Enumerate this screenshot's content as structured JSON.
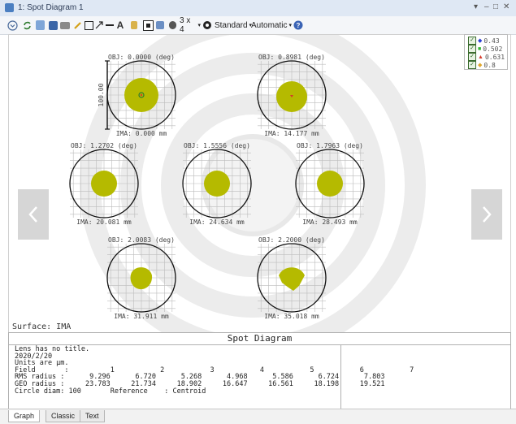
{
  "window": {
    "title": "1: Spot Diagram 1",
    "controls": [
      "▾",
      "–",
      "□",
      "✕"
    ]
  },
  "toolbar": {
    "layout_label": "3 x 4",
    "standard_label": "Standard",
    "automatic_label": "Automatic"
  },
  "legend": [
    {
      "label": "0.43",
      "color": "#2b3fd6",
      "marker": "◆"
    },
    {
      "label": "0.502",
      "color": "#2fb52f",
      "marker": "■"
    },
    {
      "label": "0.631",
      "color": "#d63a2b",
      "marker": "▲"
    },
    {
      "label": "0.8",
      "color": "#e0a62a",
      "marker": "◆"
    }
  ],
  "spots": [
    {
      "obj": "OBJ: 0.0000 (deg)",
      "ima": "IMA: 0.000 mm",
      "shape": "circle",
      "scale": "100.00"
    },
    {
      "obj": "OBJ: 0.8981 (deg)",
      "ima": "IMA: 14.177 mm",
      "shape": "circle"
    },
    {
      "obj": "OBJ: 1.2702 (deg)",
      "ima": "IMA: 20.081 mm",
      "shape": "circle"
    },
    {
      "obj": "OBJ: 1.5556 (deg)",
      "ima": "IMA: 24.634 mm",
      "shape": "circle"
    },
    {
      "obj": "OBJ: 1.7963 (deg)",
      "ima": "IMA: 28.493 mm",
      "shape": "circle"
    },
    {
      "obj": "OBJ: 2.0083 (deg)",
      "ima": "IMA: 31.911 mm",
      "shape": "blob"
    },
    {
      "obj": "OBJ: 2.2000 (deg)",
      "ima": "IMA: 35.018 mm",
      "shape": "blob2"
    }
  ],
  "surface": "Surface: IMA",
  "panel_title": "Spot Diagram",
  "info": {
    "line1": "Lens has no title.",
    "line2": "2020/2/20",
    "line3": "Units are µm.",
    "field_row": "Field       :          1           2           3           4           5           6           7",
    "rms_row": "RMS radius :      9.296      6.720      5.268      4.968      5.586      6.724      7.803",
    "geo_row": "GEO radius :     23.783     21.734     18.902     16.647     16.561     18.198     19.521",
    "circle_row": "Circle diam: 100       Reference    : Centroid"
  },
  "tabs": [
    "Graph",
    "Classic",
    "Text"
  ],
  "colors": {
    "spot": "#b5ba00",
    "grid": "#bcbcbc",
    "bg_ghost": "#e6e6e6"
  }
}
